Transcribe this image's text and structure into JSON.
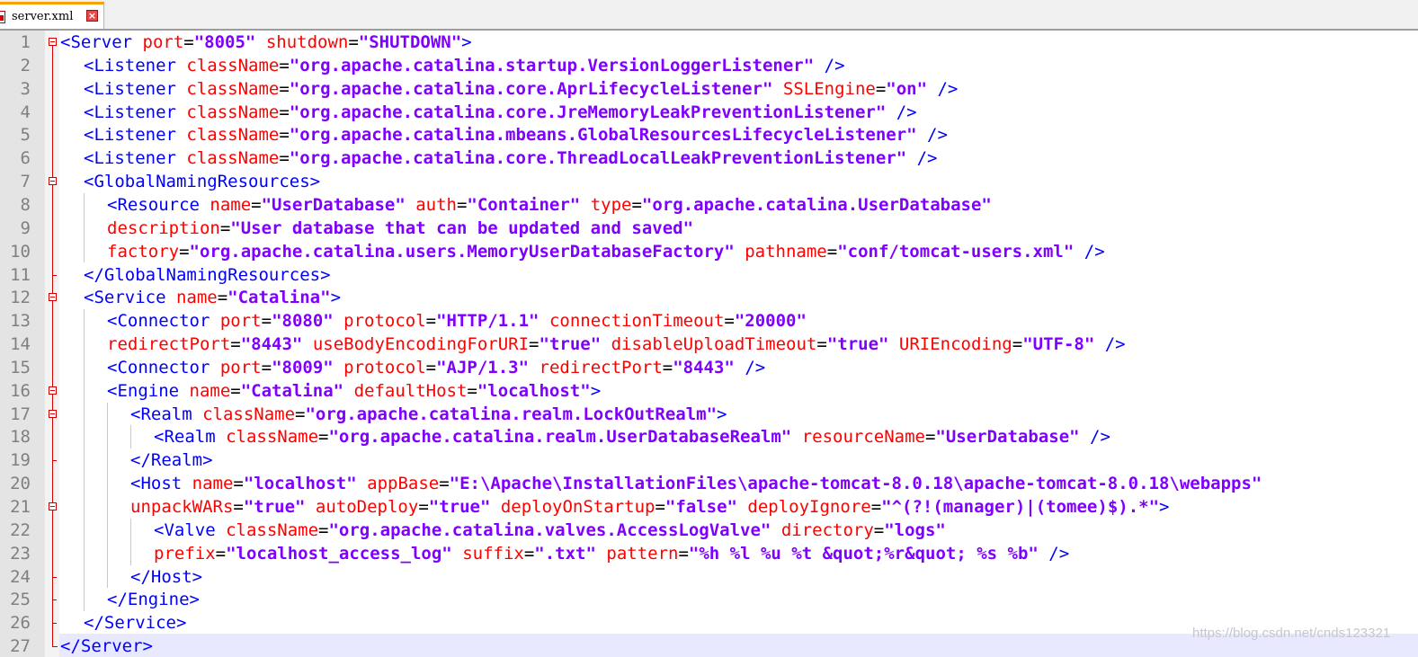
{
  "tab": {
    "filename": "server.xml",
    "close_glyph": "×"
  },
  "editor": {
    "lines": [
      {
        "num": "1",
        "fold": "open-root",
        "parts": [
          {
            "t": "tag",
            "v": "<Server "
          },
          {
            "t": "attr",
            "v": "port"
          },
          {
            "t": "eq",
            "v": "="
          },
          {
            "t": "val",
            "v": "\"8005\""
          },
          {
            "t": "attr",
            "v": " shutdown"
          },
          {
            "t": "eq",
            "v": "="
          },
          {
            "t": "val",
            "v": "\"SHUTDOWN\""
          },
          {
            "t": "tag",
            "v": ">"
          }
        ]
      },
      {
        "num": "2",
        "fold": "line",
        "parts": [
          {
            "t": "tag",
            "v": "<Listener "
          },
          {
            "t": "attr",
            "v": "className"
          },
          {
            "t": "eq",
            "v": "="
          },
          {
            "t": "val",
            "v": "\"org.apache.catalina.startup.VersionLoggerListener\""
          },
          {
            "t": "tag",
            "v": " />"
          }
        ]
      },
      {
        "num": "3",
        "fold": "line",
        "parts": [
          {
            "t": "tag",
            "v": "<Listener "
          },
          {
            "t": "attr",
            "v": "className"
          },
          {
            "t": "eq",
            "v": "="
          },
          {
            "t": "val",
            "v": "\"org.apache.catalina.core.AprLifecycleListener\""
          },
          {
            "t": "attr",
            "v": " SSLEngine"
          },
          {
            "t": "eq",
            "v": "="
          },
          {
            "t": "val",
            "v": "\"on\""
          },
          {
            "t": "tag",
            "v": " />"
          }
        ]
      },
      {
        "num": "4",
        "fold": "line",
        "parts": [
          {
            "t": "tag",
            "v": "<Listener "
          },
          {
            "t": "attr",
            "v": "className"
          },
          {
            "t": "eq",
            "v": "="
          },
          {
            "t": "val",
            "v": "\"org.apache.catalina.core.JreMemoryLeakPreventionListener\""
          },
          {
            "t": "tag",
            "v": " />"
          }
        ]
      },
      {
        "num": "5",
        "fold": "line",
        "parts": [
          {
            "t": "tag",
            "v": "<Listener "
          },
          {
            "t": "attr",
            "v": "className"
          },
          {
            "t": "eq",
            "v": "="
          },
          {
            "t": "val",
            "v": "\"org.apache.catalina.mbeans.GlobalResourcesLifecycleListener\""
          },
          {
            "t": "tag",
            "v": " />"
          }
        ]
      },
      {
        "num": "6",
        "fold": "line",
        "parts": [
          {
            "t": "tag",
            "v": "<Listener "
          },
          {
            "t": "attr",
            "v": "className"
          },
          {
            "t": "eq",
            "v": "="
          },
          {
            "t": "val",
            "v": "\"org.apache.catalina.core.ThreadLocalLeakPreventionListener\""
          },
          {
            "t": "tag",
            "v": " />"
          }
        ]
      },
      {
        "num": "7",
        "fold": "open",
        "parts": [
          {
            "t": "tag",
            "v": "<GlobalNamingResources>"
          }
        ]
      },
      {
        "num": "8",
        "fold": "line",
        "parts": [
          {
            "t": "tag",
            "v": "<Resource "
          },
          {
            "t": "attr",
            "v": "name"
          },
          {
            "t": "eq",
            "v": "="
          },
          {
            "t": "val",
            "v": "\"UserDatabase\""
          },
          {
            "t": "attr",
            "v": " auth"
          },
          {
            "t": "eq",
            "v": "="
          },
          {
            "t": "val",
            "v": "\"Container\""
          },
          {
            "t": "attr",
            "v": " type"
          },
          {
            "t": "eq",
            "v": "="
          },
          {
            "t": "val",
            "v": "\"org.apache.catalina.UserDatabase\""
          }
        ]
      },
      {
        "num": "9",
        "fold": "line",
        "parts": [
          {
            "t": "attr",
            "v": "description"
          },
          {
            "t": "eq",
            "v": "="
          },
          {
            "t": "val",
            "v": "\"User database that can be updated and saved\""
          }
        ]
      },
      {
        "num": "10",
        "fold": "line",
        "parts": [
          {
            "t": "attr",
            "v": "factory"
          },
          {
            "t": "eq",
            "v": "="
          },
          {
            "t": "val",
            "v": "\"org.apache.catalina.users.MemoryUserDatabaseFactory\""
          },
          {
            "t": "attr",
            "v": " pathname"
          },
          {
            "t": "eq",
            "v": "="
          },
          {
            "t": "val",
            "v": "\"conf/tomcat-users.xml\""
          },
          {
            "t": "tag",
            "v": " />"
          }
        ]
      },
      {
        "num": "11",
        "fold": "tick",
        "parts": [
          {
            "t": "tag",
            "v": "</GlobalNamingResources>"
          }
        ]
      },
      {
        "num": "12",
        "fold": "open",
        "parts": [
          {
            "t": "tag",
            "v": "<Service "
          },
          {
            "t": "attr",
            "v": "name"
          },
          {
            "t": "eq",
            "v": "="
          },
          {
            "t": "val",
            "v": "\"Catalina\""
          },
          {
            "t": "tag",
            "v": ">"
          }
        ]
      },
      {
        "num": "13",
        "fold": "line",
        "parts": [
          {
            "t": "tag",
            "v": "<Connector "
          },
          {
            "t": "attr",
            "v": "port"
          },
          {
            "t": "eq",
            "v": "="
          },
          {
            "t": "val",
            "v": "\"8080\""
          },
          {
            "t": "attr",
            "v": " protocol"
          },
          {
            "t": "eq",
            "v": "="
          },
          {
            "t": "val",
            "v": "\"HTTP/1.1\""
          },
          {
            "t": "attr",
            "v": " connectionTimeout"
          },
          {
            "t": "eq",
            "v": "="
          },
          {
            "t": "val",
            "v": "\"20000\""
          }
        ]
      },
      {
        "num": "14",
        "fold": "line",
        "parts": [
          {
            "t": "attr",
            "v": "redirectPort"
          },
          {
            "t": "eq",
            "v": "="
          },
          {
            "t": "val",
            "v": "\"8443\""
          },
          {
            "t": "attr",
            "v": " useBodyEncodingForURI"
          },
          {
            "t": "eq",
            "v": "="
          },
          {
            "t": "val",
            "v": "\"true\""
          },
          {
            "t": "attr",
            "v": " disableUploadTimeout"
          },
          {
            "t": "eq",
            "v": "="
          },
          {
            "t": "val",
            "v": "\"true\""
          },
          {
            "t": "attr",
            "v": " URIEncoding"
          },
          {
            "t": "eq",
            "v": "="
          },
          {
            "t": "val",
            "v": "\"UTF-8\""
          },
          {
            "t": "tag",
            "v": " />"
          }
        ]
      },
      {
        "num": "15",
        "fold": "line",
        "parts": [
          {
            "t": "tag",
            "v": "<Connector "
          },
          {
            "t": "attr",
            "v": "port"
          },
          {
            "t": "eq",
            "v": "="
          },
          {
            "t": "val",
            "v": "\"8009\""
          },
          {
            "t": "attr",
            "v": " protocol"
          },
          {
            "t": "eq",
            "v": "="
          },
          {
            "t": "val",
            "v": "\"AJP/1.3\""
          },
          {
            "t": "attr",
            "v": " redirectPort"
          },
          {
            "t": "eq",
            "v": "="
          },
          {
            "t": "val",
            "v": "\"8443\""
          },
          {
            "t": "tag",
            "v": " />"
          }
        ]
      },
      {
        "num": "16",
        "fold": "open",
        "parts": [
          {
            "t": "tag",
            "v": "<Engine "
          },
          {
            "t": "attr",
            "v": "name"
          },
          {
            "t": "eq",
            "v": "="
          },
          {
            "t": "val",
            "v": "\"Catalina\""
          },
          {
            "t": "attr",
            "v": " defaultHost"
          },
          {
            "t": "eq",
            "v": "="
          },
          {
            "t": "val",
            "v": "\"localhost\""
          },
          {
            "t": "tag",
            "v": ">"
          }
        ]
      },
      {
        "num": "17",
        "fold": "open",
        "parts": [
          {
            "t": "tag",
            "v": "<Realm "
          },
          {
            "t": "attr",
            "v": "className"
          },
          {
            "t": "eq",
            "v": "="
          },
          {
            "t": "val",
            "v": "\"org.apache.catalina.realm.LockOutRealm\""
          },
          {
            "t": "tag",
            "v": ">"
          }
        ]
      },
      {
        "num": "18",
        "fold": "line",
        "parts": [
          {
            "t": "tag",
            "v": "<Realm "
          },
          {
            "t": "attr",
            "v": "className"
          },
          {
            "t": "eq",
            "v": "="
          },
          {
            "t": "val",
            "v": "\"org.apache.catalina.realm.UserDatabaseRealm\""
          },
          {
            "t": "attr",
            "v": " resourceName"
          },
          {
            "t": "eq",
            "v": "="
          },
          {
            "t": "val",
            "v": "\"UserDatabase\""
          },
          {
            "t": "tag",
            "v": " />"
          }
        ]
      },
      {
        "num": "19",
        "fold": "tick",
        "parts": [
          {
            "t": "tag",
            "v": "</Realm>"
          }
        ]
      },
      {
        "num": "20",
        "fold": "line",
        "parts": [
          {
            "t": "tag",
            "v": "<Host "
          },
          {
            "t": "attr",
            "v": "name"
          },
          {
            "t": "eq",
            "v": "="
          },
          {
            "t": "val",
            "v": "\"localhost\""
          },
          {
            "t": "attr",
            "v": " appBase"
          },
          {
            "t": "eq",
            "v": "="
          },
          {
            "t": "val",
            "v": "\"E:\\Apache\\InstallationFiles\\apache-tomcat-8.0.18\\apache-tomcat-8.0.18\\webapps\""
          }
        ]
      },
      {
        "num": "21",
        "fold": "open",
        "parts": [
          {
            "t": "attr",
            "v": "unpackWARs"
          },
          {
            "t": "eq",
            "v": "="
          },
          {
            "t": "val",
            "v": "\"true\""
          },
          {
            "t": "attr",
            "v": " autoDeploy"
          },
          {
            "t": "eq",
            "v": "="
          },
          {
            "t": "val",
            "v": "\"true\""
          },
          {
            "t": "attr",
            "v": " deployOnStartup"
          },
          {
            "t": "eq",
            "v": "="
          },
          {
            "t": "val",
            "v": "\"false\""
          },
          {
            "t": "attr",
            "v": " deployIgnore"
          },
          {
            "t": "eq",
            "v": "="
          },
          {
            "t": "val",
            "v": "\"^(?!(manager)|(tomee)$).*\""
          },
          {
            "t": "tag",
            "v": ">"
          }
        ]
      },
      {
        "num": "22",
        "fold": "line",
        "parts": [
          {
            "t": "tag",
            "v": "<Valve "
          },
          {
            "t": "attr",
            "v": "className"
          },
          {
            "t": "eq",
            "v": "="
          },
          {
            "t": "val",
            "v": "\"org.apache.catalina.valves.AccessLogValve\""
          },
          {
            "t": "attr",
            "v": " directory"
          },
          {
            "t": "eq",
            "v": "="
          },
          {
            "t": "val",
            "v": "\"logs\""
          }
        ]
      },
      {
        "num": "23",
        "fold": "line",
        "parts": [
          {
            "t": "attr",
            "v": "prefix"
          },
          {
            "t": "eq",
            "v": "="
          },
          {
            "t": "val",
            "v": "\"localhost_access_log\""
          },
          {
            "t": "attr",
            "v": " suffix"
          },
          {
            "t": "eq",
            "v": "="
          },
          {
            "t": "val",
            "v": "\".txt\""
          },
          {
            "t": "attr",
            "v": " pattern"
          },
          {
            "t": "eq",
            "v": "="
          },
          {
            "t": "val",
            "v": "\"%h %l %u %t &quot;%r&quot; %s %b\""
          },
          {
            "t": "tag",
            "v": " />"
          }
        ]
      },
      {
        "num": "24",
        "fold": "tick",
        "parts": [
          {
            "t": "tag",
            "v": "</Host>"
          }
        ]
      },
      {
        "num": "25",
        "fold": "tick",
        "parts": [
          {
            "t": "tag",
            "v": "</Engine>"
          }
        ]
      },
      {
        "num": "26",
        "fold": "tick",
        "parts": [
          {
            "t": "tag",
            "v": "</Service>"
          }
        ]
      },
      {
        "num": "27",
        "fold": "end",
        "parts": [
          {
            "t": "tag",
            "v": "</Server>"
          }
        ]
      }
    ]
  },
  "colors": {
    "tag": "#0000ff",
    "attribute": "#ff0000",
    "value": "#8000ff",
    "fold_marker": "#d00000",
    "active_tab_accent": "#f7a000"
  },
  "watermark": "https://blog.csdn.net/cnds123321"
}
